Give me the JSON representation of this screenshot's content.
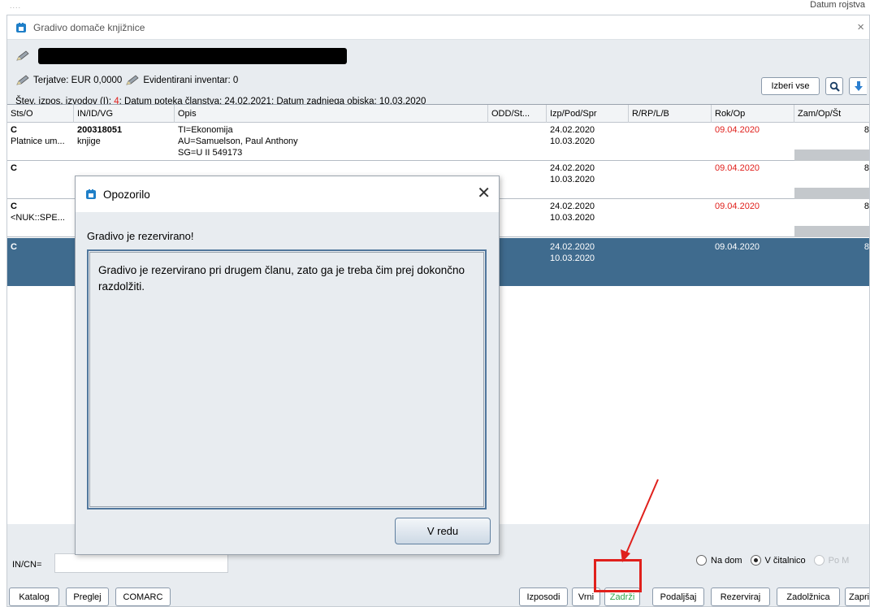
{
  "main_window": {
    "title": "Gradivo domače knjižnice",
    "close_glyph": "×",
    "partial_top_text": "Datum rojstva"
  },
  "member_info": {
    "obligations": "Terjatve: EUR 0,0000",
    "inventory": "Evidentirani inventar: 0",
    "stats_prefix": "Štev. izpos. izvodov (I): ",
    "loan_count": "4",
    "stats_suffix": "; Datum poteka članstva: 24.02.2021; Datum zadnjega obiska: 10.03.2020"
  },
  "toolbar": {
    "select_all": "Izberi vse"
  },
  "table": {
    "columns": [
      "Sts/O",
      "IN/ID/VG",
      "Opis",
      "ODD/St...",
      "Izp/Pod/Spr",
      "R/RP/L/B",
      "Rok/Op",
      "Zam/Op/Št"
    ],
    "rows": [
      {
        "sts": "C",
        "sts2": "Platnice um...",
        "id": "200318051",
        "id2": "knjige",
        "opis1": "TI=Ekonomija",
        "opis2": "AU=Samuelson, Paul Anthony",
        "opis3": "SG=U II 549173",
        "izp1": "24.02.2020",
        "izp2": "10.03.2020",
        "rok": "09.04.2020",
        "zam": "8"
      },
      {
        "sts": "C",
        "izp1": "24.02.2020",
        "izp2": "10.03.2020",
        "rok": "09.04.2020",
        "zam": "8"
      },
      {
        "sts": "C",
        "sts2": "<NUK::SPE...",
        "izp1": "24.02.2020",
        "izp2": "10.03.2020",
        "rok": "09.04.2020",
        "zam": "8"
      },
      {
        "sts": "C",
        "izp1": "24.02.2020",
        "izp2": "10.03.2020",
        "rok": "09.04.2020",
        "zam": "8"
      }
    ]
  },
  "bottom": {
    "incn_label": "IN/CN=",
    "radio_home": "Na dom",
    "radio_reading": "V čitalnico",
    "radio_other": "Po M",
    "buttons": {
      "katalog": "Katalog",
      "preglej": "Preglej",
      "comarc": "COMARC",
      "izposodi": "Izposodi",
      "vrni": "Vrni",
      "zadrzi": "Zadrži",
      "podaljsaj": "Podaljšaj",
      "rezerviraj": "Rezerviraj",
      "zadolznica": "Zadolžnica",
      "zapri": "Zapri"
    }
  },
  "dialog": {
    "title": "Opozorilo",
    "close_glyph": "✕",
    "heading": "Gradivo je rezervirano!",
    "message": "Gradivo je rezervirano pri drugem članu, zato ga je treba čim prej dokončno razdolžiti.",
    "ok_label": "V redu"
  },
  "colors": {
    "selected_row": "#3f6b8e",
    "overdue_date": "#e0201c",
    "highlight_text": "#2fa54a",
    "annotation": "#e0201c"
  }
}
